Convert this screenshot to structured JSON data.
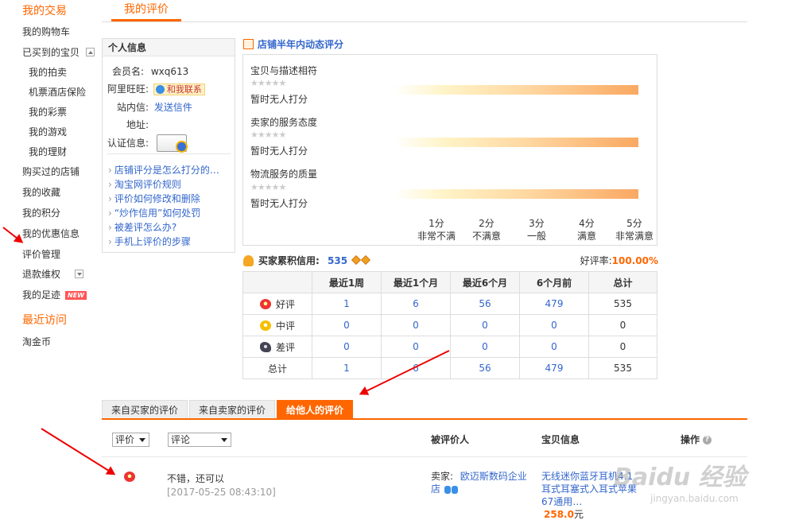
{
  "sidebar": {
    "trade_heading": "我的交易",
    "items": [
      {
        "label": "我的购物车"
      },
      {
        "label": "已买到的宝贝"
      },
      {
        "label": "我的拍卖"
      },
      {
        "label": "机票酒店保险"
      },
      {
        "label": "我的彩票"
      },
      {
        "label": "我的游戏"
      },
      {
        "label": "我的理财"
      },
      {
        "label": "购买过的店铺"
      },
      {
        "label": "我的收藏"
      },
      {
        "label": "我的积分"
      },
      {
        "label": "我的优惠信息"
      },
      {
        "label": "评价管理"
      },
      {
        "label": "退款维权"
      },
      {
        "label": "我的足迹",
        "badge": "NEW"
      }
    ],
    "recent_heading": "最近访问",
    "recent_items": [
      {
        "label": "淘金币"
      }
    ]
  },
  "header": {
    "tab_label": "我的评价"
  },
  "profile": {
    "title": "个人信息",
    "member_label": "会员名:",
    "member_value": "wxq613",
    "wangwang_label": "阿里旺旺:",
    "wangwang_value": "和我联系",
    "message_label": "站内信:",
    "message_value": "发送信件",
    "address_label": "地址:",
    "cert_label": "认证信息:",
    "faq": [
      "店铺评分是怎么打分的…",
      "淘宝网评价规则",
      "评价如何修改和删除",
      "“炒作信用”如何处罚",
      "被差评怎么办?",
      "手机上评价的步骤"
    ]
  },
  "dsr": {
    "title": "店铺半年内动态评分",
    "items": [
      {
        "label": "宝贝与描述相符",
        "status": "暂时无人打分"
      },
      {
        "label": "卖家的服务态度",
        "status": "暂时无人打分"
      },
      {
        "label": "物流服务的质量",
        "status": "暂时无人打分"
      }
    ],
    "scale": [
      {
        "score": "1分",
        "desc": "非常不满"
      },
      {
        "score": "2分",
        "desc": "不满意"
      },
      {
        "score": "3分",
        "desc": "一般"
      },
      {
        "score": "4分",
        "desc": "满意"
      },
      {
        "score": "5分",
        "desc": "非常满意"
      }
    ]
  },
  "credit": {
    "label": "买家累积信用:",
    "value": "535",
    "good_rate_label": "好评率:",
    "good_rate_value": "100.00%"
  },
  "stats_table": {
    "headers": [
      "",
      "最近1周",
      "最近1个月",
      "最近6个月",
      "6个月前",
      "总计"
    ],
    "rows": [
      {
        "label": "好评",
        "icon": "red-flower",
        "values": [
          "1",
          "6",
          "56",
          "479",
          "535"
        ]
      },
      {
        "label": "中评",
        "icon": "yellow-flower",
        "values": [
          "0",
          "0",
          "0",
          "0",
          "0"
        ]
      },
      {
        "label": "差评",
        "icon": "broken-flower",
        "values": [
          "0",
          "0",
          "0",
          "0",
          "0"
        ]
      },
      {
        "label": "总计",
        "icon": "",
        "values": [
          "1",
          "6",
          "56",
          "479",
          "535"
        ]
      }
    ]
  },
  "review_tabs": [
    {
      "label": "来自买家的评价",
      "active": false
    },
    {
      "label": "来自卖家的评价",
      "active": false
    },
    {
      "label": "给他人的评价",
      "active": true
    }
  ],
  "filters": {
    "rating_select": "评价",
    "comment_select": "评论"
  },
  "columns": {
    "rated_person": "被评价人",
    "item_info": "宝贝信息",
    "operation": "操作"
  },
  "reviews": [
    {
      "icon": "red-flower",
      "text": "不错，还可以",
      "time": "[2017-05-25 08:43:10]",
      "seller_label": "卖家:",
      "seller_name": "欧迈斯数码企业店",
      "item_title": "无线迷你蓝牙耳机4.1耳式耳塞式入耳式苹果67通用…",
      "price": "258.0",
      "price_unit": "元"
    }
  ],
  "watermark": {
    "text": "Baidu 经验",
    "sub": "jingyan.baidu.com"
  },
  "colors": {
    "accent": "#ff6600",
    "link": "#3366cc",
    "arrow": "#e00000"
  }
}
